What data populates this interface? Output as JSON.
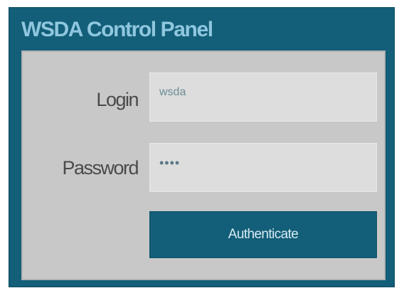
{
  "panel": {
    "title": "WSDA Control Panel"
  },
  "form": {
    "login_label": "Login",
    "login_value": "wsda",
    "password_label": "Password",
    "password_value": "••••",
    "submit_label": "Authenticate"
  },
  "colors": {
    "panel_background": "#135e78",
    "title_text": "#8fc7de",
    "body_background": "#c8c8c8",
    "input_background": "#dddddd",
    "button_background": "#135e78"
  }
}
